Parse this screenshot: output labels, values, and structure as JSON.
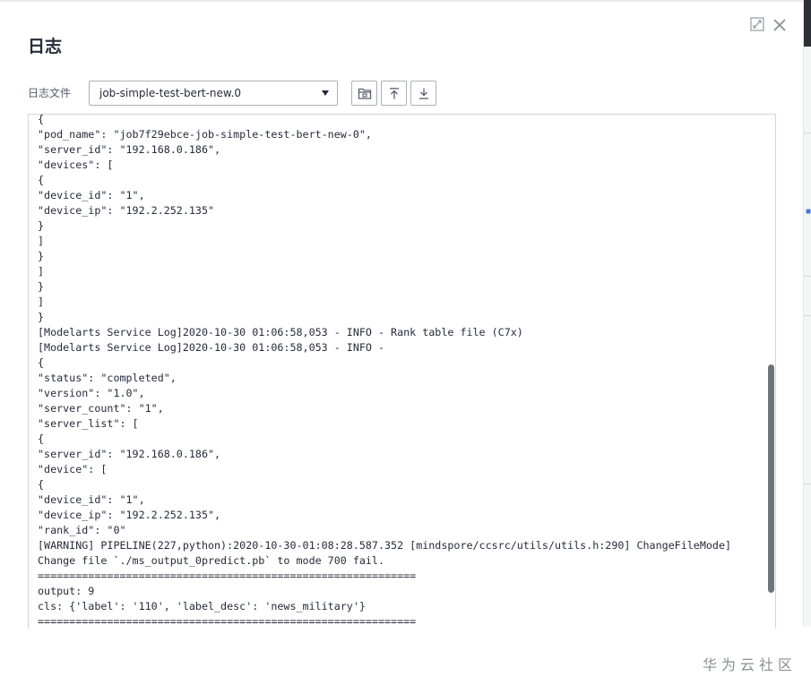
{
  "dialog": {
    "title": "日志"
  },
  "toolbar": {
    "file_label": "日志文件",
    "selected_file": "job-simple-test-bert-new.0",
    "buttons": [
      {
        "name": "open-folder",
        "icon": "folder-icon"
      },
      {
        "name": "scroll-top",
        "icon": "arrow-up-to-top-icon"
      },
      {
        "name": "download",
        "icon": "download-icon"
      }
    ]
  },
  "log": {
    "lines": [
      "{",
      "\"pod_name\": \"job7f29ebce-job-simple-test-bert-new-0\",",
      "\"server_id\": \"192.168.0.186\",",
      "\"devices\": [",
      "{",
      "\"device_id\": \"1\",",
      "\"device_ip\": \"192.2.252.135\"",
      "}",
      "]",
      "}",
      "]",
      "}",
      "]",
      "}",
      "[Modelarts Service Log]2020-10-30 01:06:58,053 - INFO - Rank table file (C7x)",
      "[Modelarts Service Log]2020-10-30 01:06:58,053 - INFO -",
      "{",
      "\"status\": \"completed\",",
      "\"version\": \"1.0\",",
      "\"server_count\": \"1\",",
      "\"server_list\": [",
      "{",
      "\"server_id\": \"192.168.0.186\",",
      "\"device\": [",
      "{",
      "\"device_id\": \"1\",",
      "\"device_ip\": \"192.2.252.135\",",
      "\"rank_id\": \"0\"",
      "[WARNING] PIPELINE(227,python):2020-10-30-01:08:28.587.352 [mindspore/ccsrc/utils/utils.h:290] ChangeFileMode]",
      "Change file `./ms_output_0predict.pb` to mode 700 fail.",
      "============================================================",
      "output: 9",
      "cls: {'label': '110', 'label_desc': 'news_military'}",
      "============================================================"
    ]
  },
  "watermark": {
    "text": "华为云社区"
  },
  "colors": {
    "text": "#252b3a",
    "border": "#adb0b8",
    "scrollbar": "#6f737b"
  }
}
